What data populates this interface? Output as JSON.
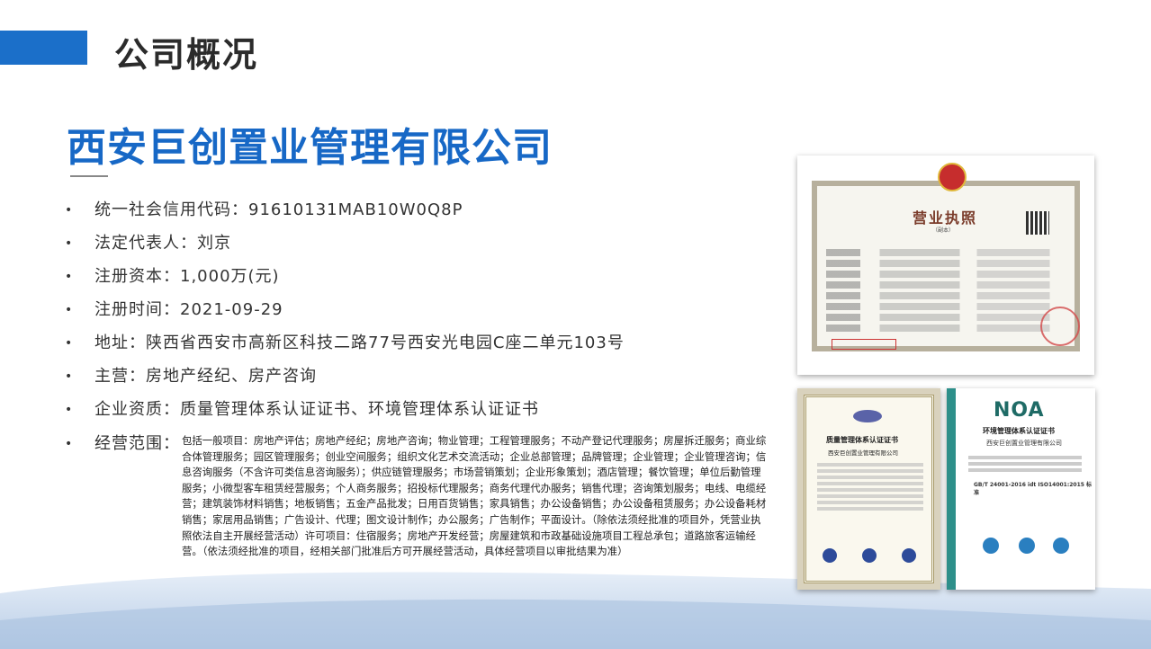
{
  "header": {
    "title": "公司概况"
  },
  "company": {
    "name": "西安巨创置业管理有限公司"
  },
  "info": {
    "items": [
      {
        "bullet": "•",
        "text": "统一社会信用代码：91610131MAB10W0Q8P"
      },
      {
        "bullet": "•",
        "text": "法定代表人：刘京"
      },
      {
        "bullet": "•",
        "text": "注册资本：1,000万(元)"
      },
      {
        "bullet": "•",
        "text": "注册时间：2021-09-29"
      },
      {
        "bullet": "•",
        "text": "地址：陕西省西安市高新区科技二路77号西安光电园C座二单元103号"
      },
      {
        "bullet": "•",
        "text": "主营：房地产经纪、房产咨询"
      },
      {
        "bullet": "•",
        "text": "企业资质：质量管理体系认证证书、环境管理体系认证证书"
      }
    ],
    "scope": {
      "bullet": "•",
      "label": "经营范围：",
      "text": "包括一般项目：房地产评估；房地产经纪；房地产咨询；物业管理；工程管理服务；不动产登记代理服务；房屋拆迁服务；商业综合体管理服务；园区管理服务；创业空间服务；组织文化艺术交流活动；企业总部管理；品牌管理；企业管理；企业管理咨询；信息咨询服务（不含许可类信息咨询服务）；供应链管理服务；市场营销策划；企业形象策划；酒店管理；餐饮管理；单位后勤管理服务；小微型客车租赁经营服务；个人商务服务；招投标代理服务；商务代理代办服务；销售代理；咨询策划服务；电线、电缆经营；建筑装饰材料销售；地板销售；五金产品批发；日用百货销售；家具销售；办公设备销售；办公设备租赁服务；办公设备耗材销售；家居用品销售；广告设计、代理；图文设计制作；办公服务；广告制作；平面设计。（除依法须经批准的项目外，凭营业执照依法自主开展经营活动）许可项目：住宿服务；房地产开发经营；房屋建筑和市政基础设施项目工程总承包；道路旅客运输经营。（依法须经批准的项目，经相关部门批准后方可开展经营活动，具体经营项目以审批结果为准）"
    }
  },
  "certificates": {
    "license": {
      "title": "营业执照",
      "subtitle": "（副本）"
    },
    "qms": {
      "logo": "ZRX",
      "title": "质量管理体系认证证书",
      "company": "西安巨创置业管理有限公司"
    },
    "ems": {
      "logo": "NOA",
      "title": "环境管理体系认证证书",
      "company": "西安巨创置业管理有限公司",
      "standard": "GB/T 24001-2016 idt ISO14001:2015 标准"
    }
  },
  "colors": {
    "accent": "#1b6fc9",
    "company_name": "#1768c6"
  }
}
